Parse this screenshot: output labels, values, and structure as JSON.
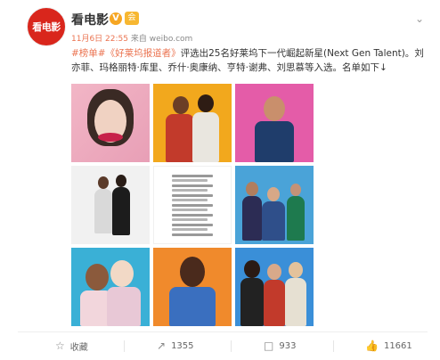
{
  "header": {
    "avatar_text": "看电影",
    "username": "看电影",
    "verified_mark": "V",
    "member_mark": "会",
    "time": "11月6日 22:55",
    "source_prefix": "来自",
    "source": "weibo.com"
  },
  "post": {
    "hashtag": "#榜单#",
    "book_link": "《好莱坞报道者》",
    "text_1": "评选出25名好莱坞下一代崛起新星(Next Gen Talent)。",
    "text_2": "刘亦菲、玛格丽特·库里、乔什·奥康纳、亨特·谢弗、刘思慕等入选。名单如下↓"
  },
  "actions": {
    "favorite": "收藏",
    "repost": "1355",
    "comment": "933",
    "like": "11661"
  },
  "icons": {
    "favorite": "star-icon",
    "repost": "repost-icon",
    "comment": "comment-icon",
    "like": "thumbs-up-icon",
    "menu": "chevron-down-icon"
  },
  "colors": {
    "accent": "#eb7350",
    "avatar_bg": "#d9261c",
    "verified": "#f6a623"
  }
}
